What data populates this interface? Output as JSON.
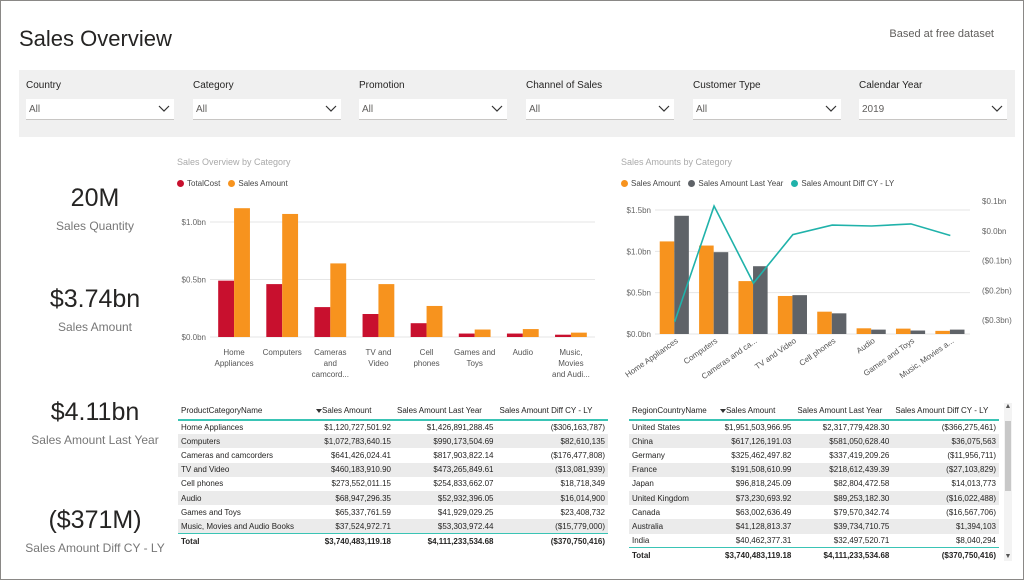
{
  "header": {
    "title": "Sales Overview",
    "subtitle": "Based at free dataset"
  },
  "colors": {
    "red": "#c8102e",
    "orange": "#f7931e",
    "gray": "#5f6368",
    "teal": "#20b2aa"
  },
  "filters": [
    {
      "label": "Country",
      "value": "All"
    },
    {
      "label": "Category",
      "value": "All"
    },
    {
      "label": "Promotion",
      "value": "All"
    },
    {
      "label": "Channel of Sales",
      "value": "All"
    },
    {
      "label": "Customer Type",
      "value": "All"
    },
    {
      "label": "Calendar Year",
      "value": "2019"
    }
  ],
  "kpis": [
    {
      "value": "20M",
      "caption": "Sales Quantity"
    },
    {
      "value": "$3.74bn",
      "caption": "Sales Amount"
    },
    {
      "value": "$4.11bn",
      "caption": "Sales Amount Last Year"
    },
    {
      "value": "($371M)",
      "caption": "Sales Amount Diff CY - LY"
    }
  ],
  "chart_data": [
    {
      "type": "bar",
      "title": "Sales Overview by Category",
      "categories": [
        "Home Appliances",
        "Computers",
        "Cameras and camcorders",
        "TV and Video",
        "Cell phones",
        "Games and Toys",
        "Audio",
        "Music, Movies and Audio Books"
      ],
      "category_labels": [
        [
          "Home",
          "Appliances"
        ],
        [
          "Computers"
        ],
        [
          "Cameras",
          "and",
          "camcord..."
        ],
        [
          "TV and",
          "Video"
        ],
        [
          "Cell",
          "phones"
        ],
        [
          "Games and",
          "Toys"
        ],
        [
          "Audio"
        ],
        [
          "Music,",
          "Movies",
          "and Audi..."
        ]
      ],
      "series": [
        {
          "name": "TotalCost",
          "values": [
            0.49,
            0.46,
            0.26,
            0.2,
            0.12,
            0.03,
            0.03,
            0.02
          ]
        },
        {
          "name": "Sales Amount",
          "values": [
            1.12,
            1.07,
            0.64,
            0.46,
            0.27,
            0.065,
            0.069,
            0.038
          ]
        }
      ],
      "yticks": [
        "$0.0bn",
        "$0.5bn",
        "$1.0bn"
      ],
      "ytick_values": [
        0,
        0.5,
        1.0
      ],
      "ylim": [
        0,
        1.2
      ],
      "grid": true,
      "legend": "top-left"
    },
    {
      "type": "bar",
      "title": "Sales Amounts by Category",
      "categories": [
        "Home Appliances",
        "Computers",
        "Cameras and camcorders",
        "TV and Video",
        "Cell phones",
        "Audio",
        "Games and Toys",
        "Music, Movies and Audio Books"
      ],
      "category_labels": [
        "Home Appliances",
        "Computers",
        "Cameras and ca...",
        "TV and Video",
        "Cell phones",
        "Audio",
        "Games and Toys",
        "Music, Movies a..."
      ],
      "series": [
        {
          "name": "Sales Amount",
          "values": [
            1.12,
            1.07,
            0.64,
            0.46,
            0.27,
            0.069,
            0.065,
            0.038
          ]
        },
        {
          "name": "Sales Amount Last Year",
          "values": [
            1.43,
            0.99,
            0.82,
            0.47,
            0.25,
            0.053,
            0.042,
            0.053
          ]
        },
        {
          "name": "Sales Amount Diff CY - LY",
          "type": "line",
          "axis": "right",
          "values": [
            -0.306,
            0.083,
            -0.176,
            -0.013,
            0.019,
            0.016,
            0.023,
            -0.016
          ]
        }
      ],
      "yticks": [
        "$0.0bn",
        "$0.5bn",
        "$1.0bn",
        "$1.5bn"
      ],
      "ytick_values": [
        0,
        0.5,
        1.0,
        1.5
      ],
      "ylim": [
        0,
        1.5
      ],
      "y2ticks": [
        "$0.1bn",
        "$0.0bn",
        "($0.1bn)",
        "($0.2bn)",
        "($0.3bn)"
      ],
      "y2tick_values": [
        0.1,
        0.0,
        -0.1,
        -0.2,
        -0.3
      ],
      "y2lim": [
        -0.3,
        0.1
      ],
      "grid": true,
      "legend": "top-left"
    }
  ],
  "table1": {
    "columns": [
      "ProductCategoryName",
      "Sales Amount",
      "Sales Amount Last Year",
      "Sales Amount Diff CY - LY"
    ],
    "rows": [
      [
        "Home Appliances",
        "$1,120,727,501.92",
        "$1,426,891,288.45",
        "($306,163,787)"
      ],
      [
        "Computers",
        "$1,072,783,640.15",
        "$990,173,504.69",
        "$82,610,135"
      ],
      [
        "Cameras and camcorders",
        "$641,426,024.41",
        "$817,903,822.14",
        "($176,477,808)"
      ],
      [
        "TV and Video",
        "$460,183,910.90",
        "$473,265,849.61",
        "($13,081,939)"
      ],
      [
        "Cell phones",
        "$273,552,011.15",
        "$254,833,662.07",
        "$18,718,349"
      ],
      [
        "Audio",
        "$68,947,296.35",
        "$52,932,396.05",
        "$16,014,900"
      ],
      [
        "Games and Toys",
        "$65,337,761.59",
        "$41,929,029.25",
        "$23,408,732"
      ],
      [
        "Music, Movies and Audio Books",
        "$37,524,972.71",
        "$53,303,972.44",
        "($15,779,000)"
      ]
    ],
    "total": [
      "Total",
      "$3,740,483,119.18",
      "$4,111,233,534.68",
      "($370,750,416)"
    ]
  },
  "table2": {
    "columns": [
      "RegionCountryName",
      "Sales Amount",
      "Sales Amount Last Year",
      "Sales Amount Diff CY - LY"
    ],
    "rows": [
      [
        "United States",
        "$1,951,503,966.95",
        "$2,317,779,428.30",
        "($366,275,461)"
      ],
      [
        "China",
        "$617,126,191.03",
        "$581,050,628.40",
        "$36,075,563"
      ],
      [
        "Germany",
        "$325,462,497.82",
        "$337,419,209.26",
        "($11,956,711)"
      ],
      [
        "France",
        "$191,508,610.99",
        "$218,612,439.39",
        "($27,103,829)"
      ],
      [
        "Japan",
        "$96,818,245.09",
        "$82,804,472.58",
        "$14,013,773"
      ],
      [
        "United Kingdom",
        "$73,230,693.92",
        "$89,253,182.30",
        "($16,022,488)"
      ],
      [
        "Canada",
        "$63,002,636.49",
        "$79,570,342.74",
        "($16,567,706)"
      ],
      [
        "Australia",
        "$41,128,813.37",
        "$39,734,710.75",
        "$1,394,103"
      ],
      [
        "India",
        "$40,462,377.31",
        "$32,497,520.71",
        "$8,040,294"
      ]
    ],
    "total": [
      "Total",
      "$3,740,483,119.18",
      "$4,111,233,534.68",
      "($370,750,416)"
    ]
  }
}
